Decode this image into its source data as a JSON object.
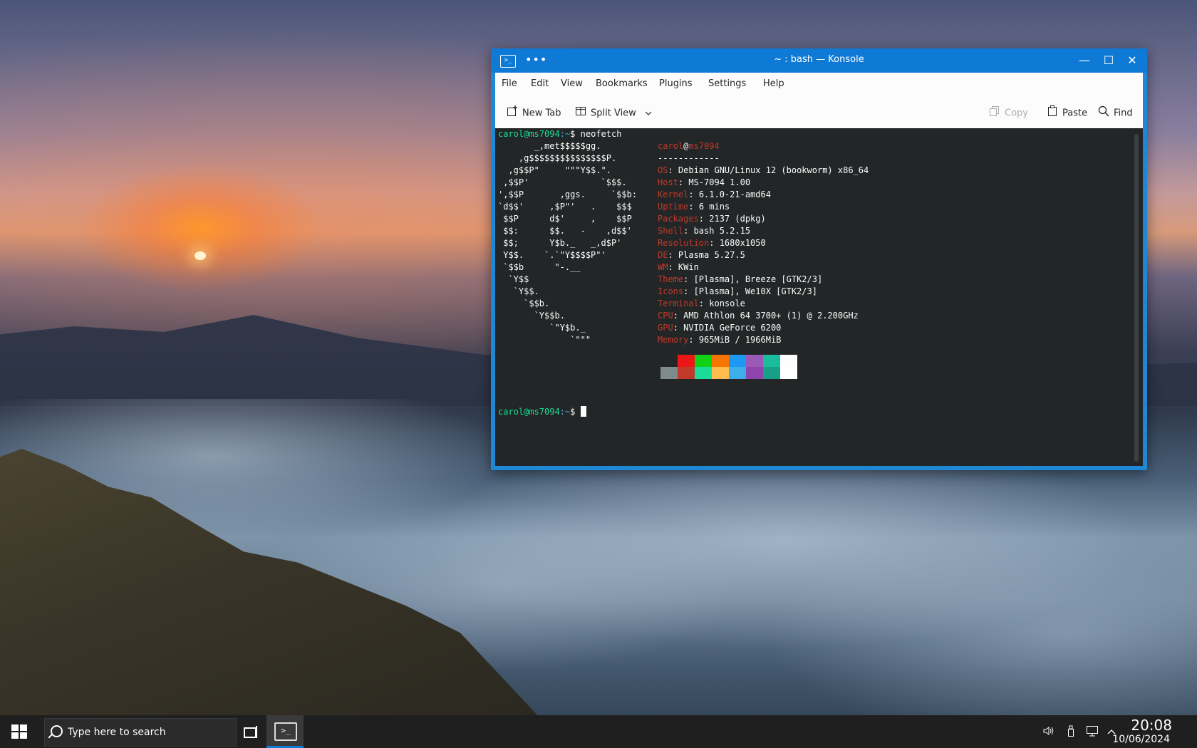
{
  "window": {
    "title": "~ : bash — Konsole",
    "app_icon": ">_",
    "dots": "•••",
    "controls": {
      "minimize": "—",
      "maximize": "☐",
      "close": "✕"
    }
  },
  "menu": [
    "File",
    "Edit",
    "View",
    "Bookmarks",
    "Plugins",
    "Settings",
    "Help"
  ],
  "toolbar": {
    "new_tab": "New Tab",
    "split_view": "Split View",
    "copy": "Copy",
    "paste": "Paste",
    "find": "Find"
  },
  "terminal": {
    "prompt_user": "carol@ms7094",
    "prompt_path": ":~",
    "prompt_symbol": "$",
    "command": "neofetch",
    "ascii": [
      "       _,met$$$$$gg.",
      "    ,g$$$$$$$$$$$$$$$P.",
      "  ,g$$P\"     \"\"\"Y$$.\".",
      " ,$$P'              `$$$.",
      "',$$P       ,ggs.     `$$b:",
      "`d$$'     ,$P\"'   .    $$$",
      " $$P      d$'     ,    $$P",
      " $$:      $$.   -    ,d$$'",
      " $$;      Y$b._   _,d$P'",
      " Y$$.    `.`\"Y$$$$P\"'",
      " `$$b      \"-.__",
      "  `Y$$",
      "   `Y$$.",
      "     `$$b.",
      "       `Y$$b.",
      "          `\"Y$b._",
      "              `\"\"\""
    ],
    "info_header_user": "carol",
    "info_header_at": "@",
    "info_header_host": "ms7094",
    "separator": "------------",
    "info": [
      {
        "label": "OS",
        "value": "Debian GNU/Linux 12 (bookworm) x86_64"
      },
      {
        "label": "Host",
        "value": "MS-7094 1.00"
      },
      {
        "label": "Kernel",
        "value": "6.1.0-21-amd64"
      },
      {
        "label": "Uptime",
        "value": "6 mins"
      },
      {
        "label": "Packages",
        "value": "2137 (dpkg)"
      },
      {
        "label": "Shell",
        "value": "bash 5.2.15"
      },
      {
        "label": "Resolution",
        "value": "1680x1050"
      },
      {
        "label": "DE",
        "value": "Plasma 5.27.5"
      },
      {
        "label": "WM",
        "value": "KWin"
      },
      {
        "label": "Theme",
        "value": "[Plasma], Breeze [GTK2/3]"
      },
      {
        "label": "Icons",
        "value": "[Plasma], We10X [GTK2/3]"
      },
      {
        "label": "Terminal",
        "value": "konsole"
      },
      {
        "label": "CPU",
        "value": "AMD Athlon 64 3700+ (1) @ 2.200GHz"
      },
      {
        "label": "GPU",
        "value": "NVIDIA GeForce 6200"
      },
      {
        "label": "Memory",
        "value": "965MiB / 1966MiB"
      }
    ],
    "palette_top": [
      "#232627",
      "#ed1515",
      "#11d116",
      "#f67400",
      "#1d99f3",
      "#9b59b6",
      "#1abc9c",
      "#fcfcfc"
    ],
    "palette_bottom": [
      "#7f8c8d",
      "#c0392b",
      "#1cdc9a",
      "#fdbc4b",
      "#3daee9",
      "#8e44ad",
      "#16a085",
      "#ffffff"
    ]
  },
  "taskbar": {
    "search_placeholder": "Type here to search",
    "time": "20:08",
    "date": "10/06/2024",
    "tray": [
      "volume-icon",
      "usb-icon",
      "network-icon",
      "chevron-up-icon"
    ]
  }
}
